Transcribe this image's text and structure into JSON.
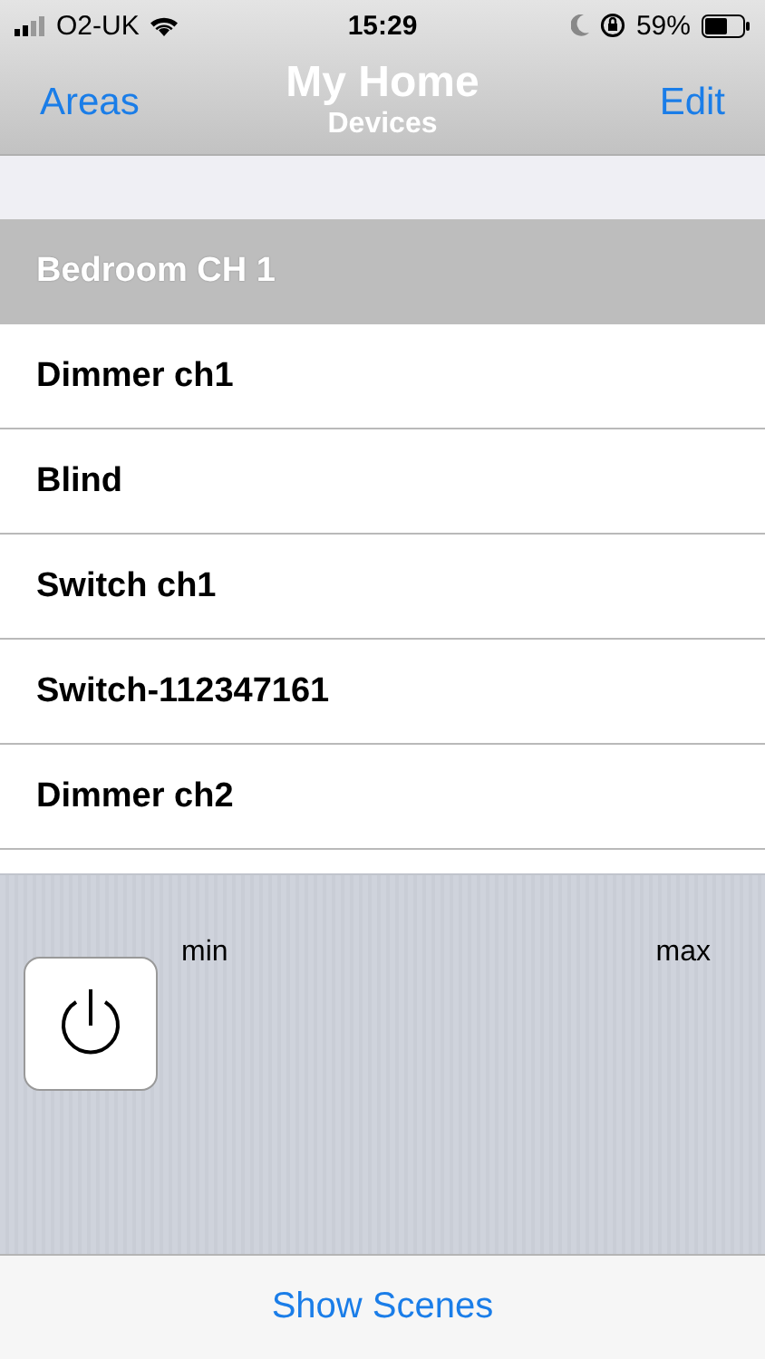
{
  "status_bar": {
    "carrier": "O2-UK",
    "time": "15:29",
    "battery": "59%"
  },
  "nav": {
    "left": "Areas",
    "title": "My Home",
    "subtitle": "Devices",
    "right": "Edit"
  },
  "section": {
    "title": "Bedroom CH 1"
  },
  "devices": [
    {
      "name": "Dimmer ch1"
    },
    {
      "name": "Blind"
    },
    {
      "name": "Switch ch1"
    },
    {
      "name": "Switch-112347161"
    },
    {
      "name": "Dimmer ch2"
    }
  ],
  "control": {
    "min_label": "min",
    "max_label": "max"
  },
  "toolbar": {
    "button": "Show Scenes"
  }
}
